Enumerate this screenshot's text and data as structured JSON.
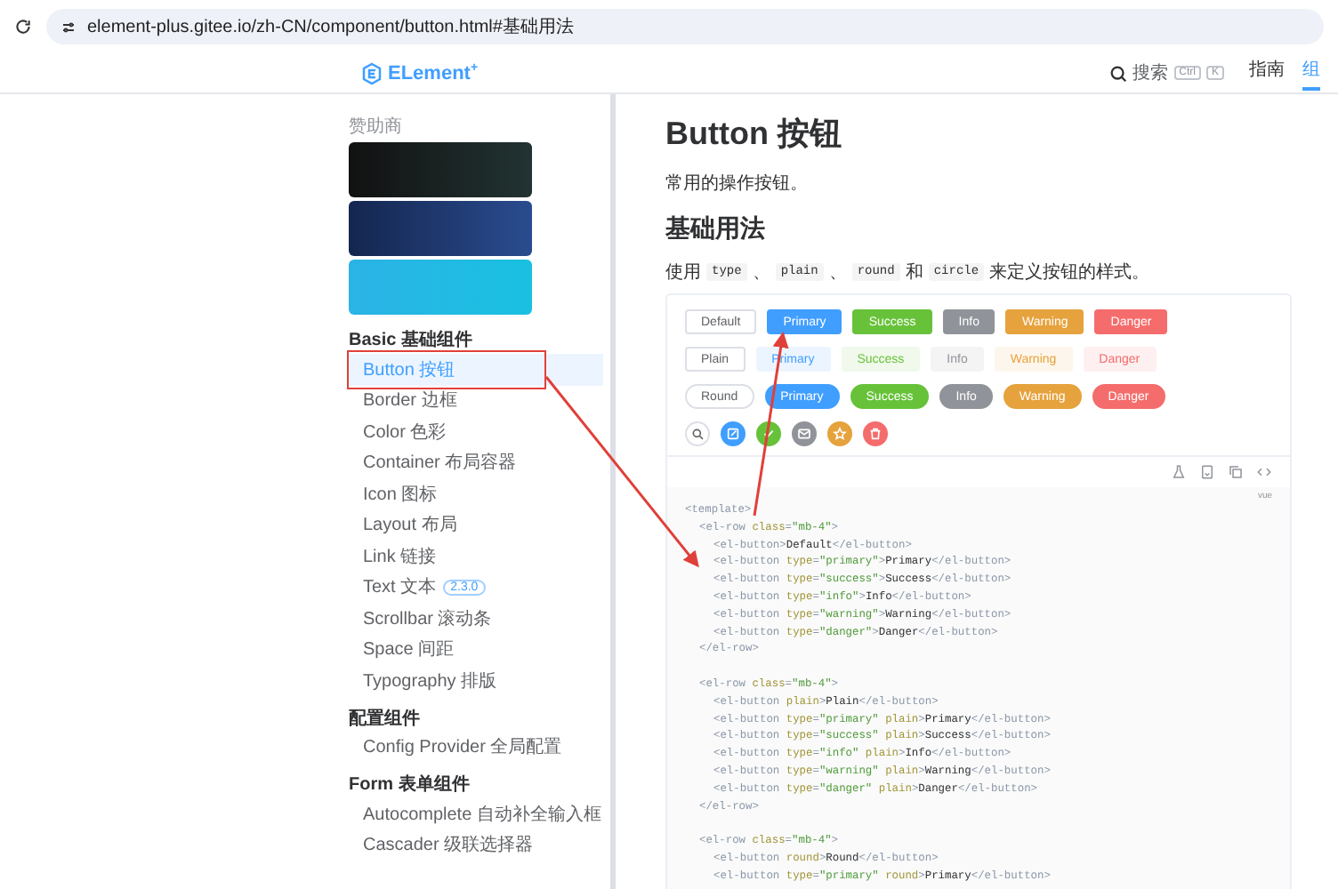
{
  "address_bar": {
    "url": "element-plus.gitee.io/zh-CN/component/button.html#基础用法"
  },
  "header": {
    "logo": "ELement",
    "logo_mark": "+",
    "search": {
      "placeholder": "搜索",
      "keys": [
        "Ctrl",
        "K"
      ]
    },
    "nav": [
      {
        "label": "指南",
        "selected": false
      },
      {
        "label": "组",
        "selected": true
      }
    ]
  },
  "sidebar": {
    "sponsor_label": "赞助商",
    "groups": [
      {
        "title": "Basic 基础组件",
        "items": [
          {
            "label": "Button 按钮",
            "selected": true
          },
          {
            "label": "Border 边框",
            "selected": false
          },
          {
            "label": "Color 色彩",
            "selected": false
          },
          {
            "label": "Container 布局容器",
            "selected": false
          },
          {
            "label": "Icon 图标",
            "selected": false
          },
          {
            "label": "Layout 布局",
            "selected": false
          },
          {
            "label": "Link 链接",
            "selected": false
          },
          {
            "label": "Text 文本",
            "badge": "2.3.0",
            "selected": false
          },
          {
            "label": "Scrollbar 滚动条",
            "selected": false
          },
          {
            "label": "Space 间距",
            "selected": false
          },
          {
            "label": "Typography 排版",
            "selected": false
          }
        ]
      },
      {
        "title": "配置组件",
        "items": [
          {
            "label": "Config Provider 全局配置",
            "selected": false
          }
        ]
      },
      {
        "title": "Form 表单组件",
        "items": [
          {
            "label": "Autocomplete 自动补全输入框",
            "selected": false
          },
          {
            "label": "Cascader 级联选择器",
            "selected": false
          }
        ]
      }
    ]
  },
  "content": {
    "title": "Button 按钮",
    "intro": "常用的操作按钮。",
    "section_title": "基础用法",
    "description": [
      {
        "kind": "text",
        "text": "使用"
      },
      {
        "kind": "code",
        "text": "type"
      },
      {
        "kind": "text",
        "text": "、"
      },
      {
        "kind": "code",
        "text": "plain"
      },
      {
        "kind": "text",
        "text": "、"
      },
      {
        "kind": "code",
        "text": "round"
      },
      {
        "kind": "text",
        "text": "和"
      },
      {
        "kind": "code",
        "text": "circle"
      },
      {
        "kind": "text",
        "text": "来定义按钮的样式。"
      }
    ],
    "demo_rows": [
      {
        "kind": "solid",
        "buttons": [
          {
            "label": "Default",
            "kind": "default"
          },
          {
            "label": "Primary",
            "kind": "primary"
          },
          {
            "label": "Success",
            "kind": "success"
          },
          {
            "label": "Info",
            "kind": "info"
          },
          {
            "label": "Warning",
            "kind": "warning"
          },
          {
            "label": "Danger",
            "kind": "danger"
          }
        ]
      },
      {
        "kind": "plain",
        "buttons": [
          {
            "label": "Plain",
            "kind": "default"
          },
          {
            "label": "Primary",
            "kind": "primary"
          },
          {
            "label": "Success",
            "kind": "success"
          },
          {
            "label": "Info",
            "kind": "info"
          },
          {
            "label": "Warning",
            "kind": "warning"
          },
          {
            "label": "Danger",
            "kind": "danger"
          }
        ]
      },
      {
        "kind": "round",
        "buttons": [
          {
            "label": "Round",
            "kind": "default"
          },
          {
            "label": "Primary",
            "kind": "primary"
          },
          {
            "label": "Success",
            "kind": "success"
          },
          {
            "label": "Info",
            "kind": "info"
          },
          {
            "label": "Warning",
            "kind": "warning"
          },
          {
            "label": "Danger",
            "kind": "danger"
          }
        ]
      },
      {
        "kind": "circle",
        "buttons": [
          {
            "kind": "default"
          },
          {
            "kind": "primary"
          },
          {
            "kind": "success"
          },
          {
            "kind": "info"
          },
          {
            "kind": "warning"
          },
          {
            "kind": "danger"
          }
        ]
      }
    ],
    "code_language": "vue",
    "code": [
      {
        "tokens": [
          {
            "kind": "tag",
            "text": "<template>"
          }
        ],
        "children": [
          {
            "tokens": [
              {
                "kind": "tag",
                "text": "<el-row "
              },
              {
                "kind": "attr",
                "text": "class"
              },
              {
                "kind": "tag",
                "text": "="
              },
              {
                "kind": "string",
                "text": "\"mb-4\""
              },
              {
                "kind": "tag",
                "text": ">"
              }
            ],
            "children": [
              {
                "tokens": [
                  {
                    "kind": "tag",
                    "text": "<el-button>"
                  },
                  {
                    "kind": "plain",
                    "text": "Default"
                  },
                  {
                    "kind": "tag",
                    "text": "</el-button>"
                  }
                ]
              },
              {
                "tokens": [
                  {
                    "kind": "tag",
                    "text": "<el-button "
                  },
                  {
                    "kind": "attr",
                    "text": "type"
                  },
                  {
                    "kind": "tag",
                    "text": "="
                  },
                  {
                    "kind": "string",
                    "text": "\"primary\""
                  },
                  {
                    "kind": "tag",
                    "text": ">"
                  },
                  {
                    "kind": "plain",
                    "text": "Primary"
                  },
                  {
                    "kind": "tag",
                    "text": "</el-button>"
                  }
                ]
              },
              {
                "tokens": [
                  {
                    "kind": "tag",
                    "text": "<el-button "
                  },
                  {
                    "kind": "attr",
                    "text": "type"
                  },
                  {
                    "kind": "tag",
                    "text": "="
                  },
                  {
                    "kind": "string",
                    "text": "\"success\""
                  },
                  {
                    "kind": "tag",
                    "text": ">"
                  },
                  {
                    "kind": "plain",
                    "text": "Success"
                  },
                  {
                    "kind": "tag",
                    "text": "</el-button>"
                  }
                ]
              },
              {
                "tokens": [
                  {
                    "kind": "tag",
                    "text": "<el-button "
                  },
                  {
                    "kind": "attr",
                    "text": "type"
                  },
                  {
                    "kind": "tag",
                    "text": "="
                  },
                  {
                    "kind": "string",
                    "text": "\"info\""
                  },
                  {
                    "kind": "tag",
                    "text": ">"
                  },
                  {
                    "kind": "plain",
                    "text": "Info"
                  },
                  {
                    "kind": "tag",
                    "text": "</el-button>"
                  }
                ]
              },
              {
                "tokens": [
                  {
                    "kind": "tag",
                    "text": "<el-button "
                  },
                  {
                    "kind": "attr",
                    "text": "type"
                  },
                  {
                    "kind": "tag",
                    "text": "="
                  },
                  {
                    "kind": "string",
                    "text": "\"warning\""
                  },
                  {
                    "kind": "tag",
                    "text": ">"
                  },
                  {
                    "kind": "plain",
                    "text": "Warning"
                  },
                  {
                    "kind": "tag",
                    "text": "</el-button>"
                  }
                ]
              },
              {
                "tokens": [
                  {
                    "kind": "tag",
                    "text": "<el-button "
                  },
                  {
                    "kind": "attr",
                    "text": "type"
                  },
                  {
                    "kind": "tag",
                    "text": "="
                  },
                  {
                    "kind": "string",
                    "text": "\"danger\""
                  },
                  {
                    "kind": "tag",
                    "text": ">"
                  },
                  {
                    "kind": "plain",
                    "text": "Danger"
                  },
                  {
                    "kind": "tag",
                    "text": "</el-button>"
                  }
                ]
              }
            ]
          },
          {
            "tokens": [
              {
                "kind": "tag",
                "text": "</el-row>"
              }
            ]
          },
          {
            "gap_before": true,
            "tokens": [
              {
                "kind": "tag",
                "text": "<el-row "
              },
              {
                "kind": "attr",
                "text": "class"
              },
              {
                "kind": "tag",
                "text": "="
              },
              {
                "kind": "string",
                "text": "\"mb-4\""
              },
              {
                "kind": "tag",
                "text": ">"
              }
            ],
            "children": [
              {
                "tokens": [
                  {
                    "kind": "tag",
                    "text": "<el-button "
                  },
                  {
                    "kind": "attr",
                    "text": "plain"
                  },
                  {
                    "kind": "tag",
                    "text": ">"
                  },
                  {
                    "kind": "plain",
                    "text": "Plain"
                  },
                  {
                    "kind": "tag",
                    "text": "</el-button>"
                  }
                ]
              },
              {
                "tokens": [
                  {
                    "kind": "tag",
                    "text": "<el-button "
                  },
                  {
                    "kind": "attr",
                    "text": "type"
                  },
                  {
                    "kind": "tag",
                    "text": "="
                  },
                  {
                    "kind": "string",
                    "text": "\"primary\""
                  },
                  {
                    "kind": "attr",
                    "text": " plain"
                  },
                  {
                    "kind": "tag",
                    "text": ">"
                  },
                  {
                    "kind": "plain",
                    "text": "Primary"
                  },
                  {
                    "kind": "tag",
                    "text": "</el-button>"
                  }
                ]
              },
              {
                "tokens": [
                  {
                    "kind": "tag",
                    "text": "<el-button "
                  },
                  {
                    "kind": "attr",
                    "text": "type"
                  },
                  {
                    "kind": "tag",
                    "text": "="
                  },
                  {
                    "kind": "string",
                    "text": "\"success\""
                  },
                  {
                    "kind": "attr",
                    "text": " plain"
                  },
                  {
                    "kind": "tag",
                    "text": ">"
                  },
                  {
                    "kind": "plain",
                    "text": "Success"
                  },
                  {
                    "kind": "tag",
                    "text": "</el-button>"
                  }
                ]
              },
              {
                "tokens": [
                  {
                    "kind": "tag",
                    "text": "<el-button "
                  },
                  {
                    "kind": "attr",
                    "text": "type"
                  },
                  {
                    "kind": "tag",
                    "text": "="
                  },
                  {
                    "kind": "string",
                    "text": "\"info\""
                  },
                  {
                    "kind": "attr",
                    "text": " plain"
                  },
                  {
                    "kind": "tag",
                    "text": ">"
                  },
                  {
                    "kind": "plain",
                    "text": "Info"
                  },
                  {
                    "kind": "tag",
                    "text": "</el-button>"
                  }
                ]
              },
              {
                "tokens": [
                  {
                    "kind": "tag",
                    "text": "<el-button "
                  },
                  {
                    "kind": "attr",
                    "text": "type"
                  },
                  {
                    "kind": "tag",
                    "text": "="
                  },
                  {
                    "kind": "string",
                    "text": "\"warning\""
                  },
                  {
                    "kind": "attr",
                    "text": " plain"
                  },
                  {
                    "kind": "tag",
                    "text": ">"
                  },
                  {
                    "kind": "plain",
                    "text": "Warning"
                  },
                  {
                    "kind": "tag",
                    "text": "</el-button>"
                  }
                ]
              },
              {
                "tokens": [
                  {
                    "kind": "tag",
                    "text": "<el-button "
                  },
                  {
                    "kind": "attr",
                    "text": "type"
                  },
                  {
                    "kind": "tag",
                    "text": "="
                  },
                  {
                    "kind": "string",
                    "text": "\"danger\""
                  },
                  {
                    "kind": "attr",
                    "text": " plain"
                  },
                  {
                    "kind": "tag",
                    "text": ">"
                  },
                  {
                    "kind": "plain",
                    "text": "Danger"
                  },
                  {
                    "kind": "tag",
                    "text": "</el-button>"
                  }
                ]
              }
            ]
          },
          {
            "tokens": [
              {
                "kind": "tag",
                "text": "</el-row>"
              }
            ]
          },
          {
            "gap_before": true,
            "tokens": [
              {
                "kind": "tag",
                "text": "<el-row "
              },
              {
                "kind": "attr",
                "text": "class"
              },
              {
                "kind": "tag",
                "text": "="
              },
              {
                "kind": "string",
                "text": "\"mb-4\""
              },
              {
                "kind": "tag",
                "text": ">"
              }
            ],
            "children": [
              {
                "tokens": [
                  {
                    "kind": "tag",
                    "text": "<el-button "
                  },
                  {
                    "kind": "attr",
                    "text": "round"
                  },
                  {
                    "kind": "tag",
                    "text": ">"
                  },
                  {
                    "kind": "plain",
                    "text": "Round"
                  },
                  {
                    "kind": "tag",
                    "text": "</el-button>"
                  }
                ]
              },
              {
                "tokens": [
                  {
                    "kind": "tag",
                    "text": "<el-button "
                  },
                  {
                    "kind": "attr",
                    "text": "type"
                  },
                  {
                    "kind": "tag",
                    "text": "="
                  },
                  {
                    "kind": "string",
                    "text": "\"primary\""
                  },
                  {
                    "kind": "attr",
                    "text": " round"
                  },
                  {
                    "kind": "tag",
                    "text": ">"
                  },
                  {
                    "kind": "plain",
                    "text": "Primary"
                  },
                  {
                    "kind": "tag",
                    "text": "</el-button>"
                  }
                ]
              }
            ]
          }
        ]
      }
    ]
  }
}
